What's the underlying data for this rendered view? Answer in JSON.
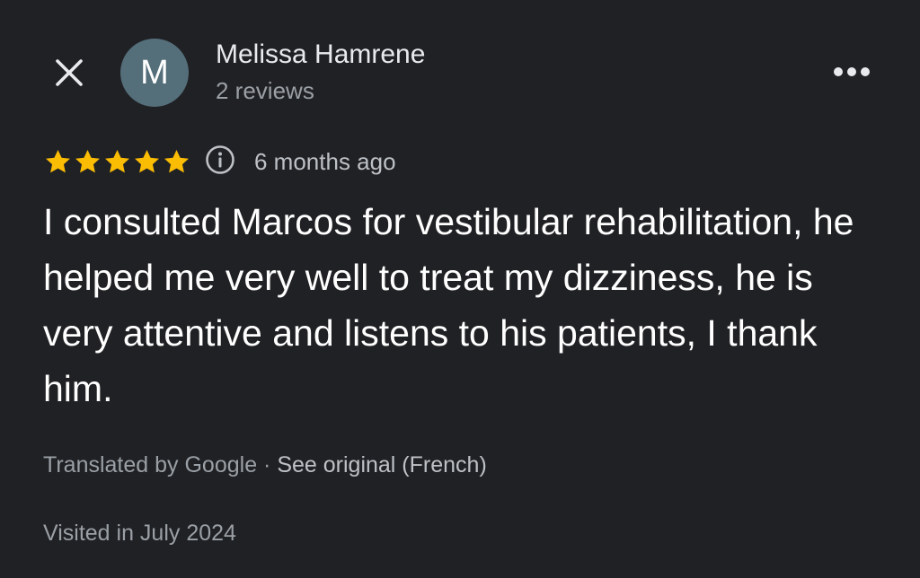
{
  "header": {
    "avatar_initial": "M",
    "reviewer_name": "Melissa Hamrene",
    "review_count": "2 reviews",
    "close_icon": "close-icon",
    "more_icon": "more-horizontal-icon"
  },
  "review": {
    "rating": 5,
    "rating_max": 5,
    "time_ago": "6 months ago",
    "text": "I consulted Marcos for vestibular rehabilitation, he helped me very well to treat my dizziness, he is very attentive and listens to his patients, I thank him.",
    "translated_by": "Translated by Google",
    "separator": " · ",
    "see_original": "See original (French)",
    "visited": "Visited in July 2024"
  },
  "colors": {
    "background": "#202124",
    "star": "#fbbc04",
    "avatar": "#546e7a",
    "primary_text": "#ffffff",
    "secondary_text": "#9aa0a6"
  }
}
